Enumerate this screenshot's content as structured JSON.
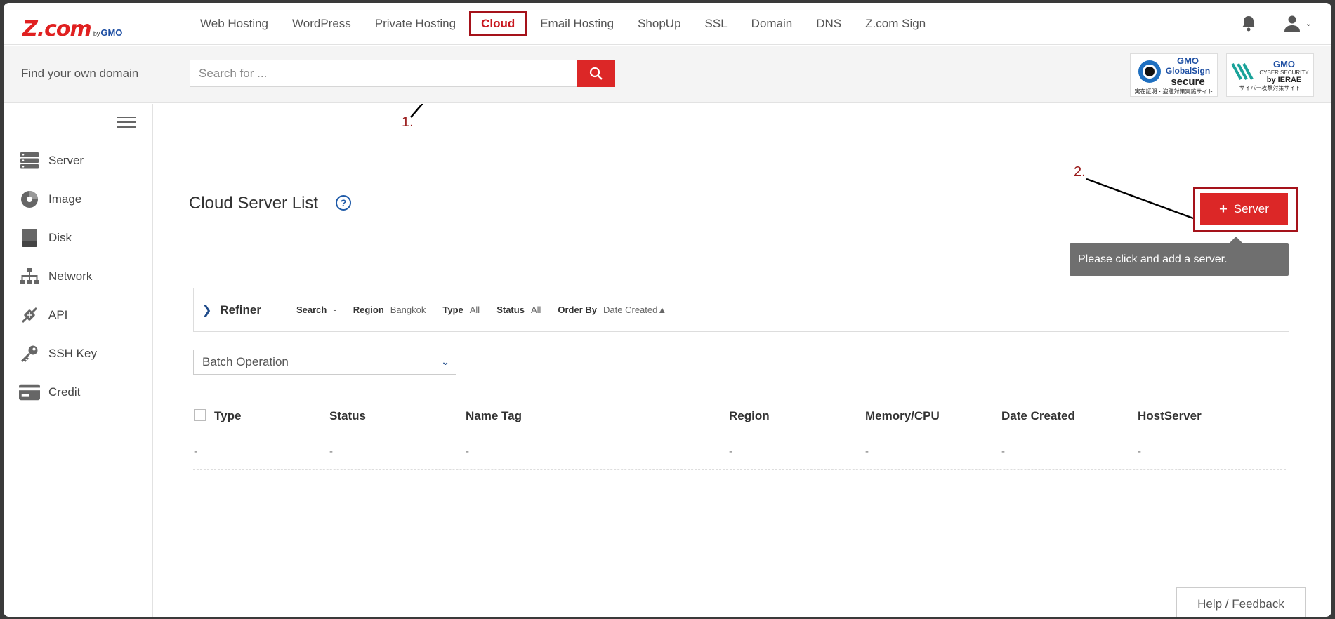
{
  "brand": {
    "logo_main": "Z.com",
    "logo_by": "by",
    "logo_gmo": "GMO"
  },
  "nav": {
    "items": [
      {
        "label": "Web Hosting"
      },
      {
        "label": "WordPress"
      },
      {
        "label": "Private Hosting"
      },
      {
        "label": "Cloud",
        "active": true
      },
      {
        "label": "Email Hosting"
      },
      {
        "label": "ShopUp"
      },
      {
        "label": "SSL"
      },
      {
        "label": "Domain"
      },
      {
        "label": "DNS"
      },
      {
        "label": "Z.com Sign"
      }
    ]
  },
  "search": {
    "label": "Find your own domain",
    "placeholder": "Search for ..."
  },
  "badges": {
    "globalsign": {
      "brand": "GMO",
      "line1": "GlobalSign",
      "line2": "secure",
      "small": "実在証明・盗聴対策実施サイト"
    },
    "ierae": {
      "brand": "GMO",
      "line1": "CYBER SECURITY",
      "line2": "by IERAE",
      "small": "サイバー攻撃対策サイト"
    }
  },
  "sidebar": {
    "items": [
      {
        "label": "Server",
        "icon": "server-icon"
      },
      {
        "label": "Image",
        "icon": "image-icon"
      },
      {
        "label": "Disk",
        "icon": "disk-icon"
      },
      {
        "label": "Network",
        "icon": "network-icon"
      },
      {
        "label": "API",
        "icon": "api-icon"
      },
      {
        "label": "SSH Key",
        "icon": "key-icon"
      },
      {
        "label": "Credit",
        "icon": "credit-card-icon"
      }
    ]
  },
  "main": {
    "title": "Cloud Server List",
    "help": "?",
    "annotation1": "1.",
    "annotation2": "2.",
    "add_button": {
      "plus": "+",
      "label": "Server"
    },
    "tooltip": "Please click and add a server.",
    "refiner": {
      "chevron": "❯",
      "title": "Refiner",
      "search_k": "Search",
      "search_v": "-",
      "region_k": "Region",
      "region_v": "Bangkok",
      "type_k": "Type",
      "type_v": "All",
      "status_k": "Status",
      "status_v": "All",
      "order_k": "Order By",
      "order_v": "Date Created▲"
    },
    "batch": {
      "label": "Batch Operation",
      "chevron": "⌄"
    },
    "table": {
      "headers": [
        "Type",
        "Status",
        "Name Tag",
        "Region",
        "Memory/CPU",
        "Date Created",
        "HostServer"
      ],
      "row": [
        "-",
        "-",
        "-",
        "-",
        "-",
        "-",
        "-"
      ]
    }
  },
  "footer": {
    "help_feedback": "Help / Feedback"
  },
  "colors": {
    "accent": "#dc2727",
    "annotation": "#a5121a",
    "link_blue": "#1e4a8a"
  }
}
